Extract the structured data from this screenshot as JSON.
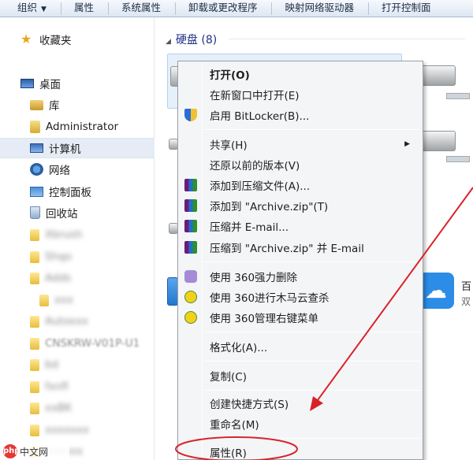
{
  "toolbar": {
    "items": [
      "组织",
      "属性",
      "系统属性",
      "卸载或更改程序",
      "映射网络驱动器",
      "打开控制面"
    ]
  },
  "nav": {
    "favorites": "收藏夹",
    "desktop": "桌面",
    "library": "库",
    "administrator": "Administrator",
    "computer": "计算机",
    "network": "网络",
    "control_panel": "控制面板",
    "recycle_bin": "回收站",
    "blurred_items": [
      "Xbrush",
      "Shqo",
      "Adds",
      "xxx",
      "Autoxxx",
      "CNSKRW-V01P-U1",
      "bd",
      "fxnfl",
      "xxBK",
      "xxxxxxx",
      "xxxxxx"
    ]
  },
  "pane": {
    "group_title": "硬盘 (8)",
    "cloud_name": "百",
    "cloud_sub": "双"
  },
  "menu": {
    "open": "打开(O)",
    "open_new_window": "在新窗口中打开(E)",
    "bitlocker": "启用 BitLocker(B)...",
    "share": "共享(H)",
    "restore": "还原以前的版本(V)",
    "add_archive": "添加到压缩文件(A)...",
    "add_zip": "添加到 \"Archive.zip\"(T)",
    "compress_email": "压缩并 E-mail...",
    "compress_zip_email": "压缩到 \"Archive.zip\" 并 E-mail",
    "del_360": "使用 360强力删除",
    "scan_360": "使用 360进行木马云查杀",
    "manage_360": "使用 360管理右键菜单",
    "format": "格式化(A)...",
    "copy": "复制(C)",
    "shortcut": "创建快捷方式(S)",
    "rename": "重命名(M)",
    "properties": "属性(R)"
  },
  "watermark": {
    "logo": "php",
    "text": "中文网"
  },
  "colors": {
    "annotation_red": "#d8232a",
    "selection": "#e6f0fa"
  }
}
